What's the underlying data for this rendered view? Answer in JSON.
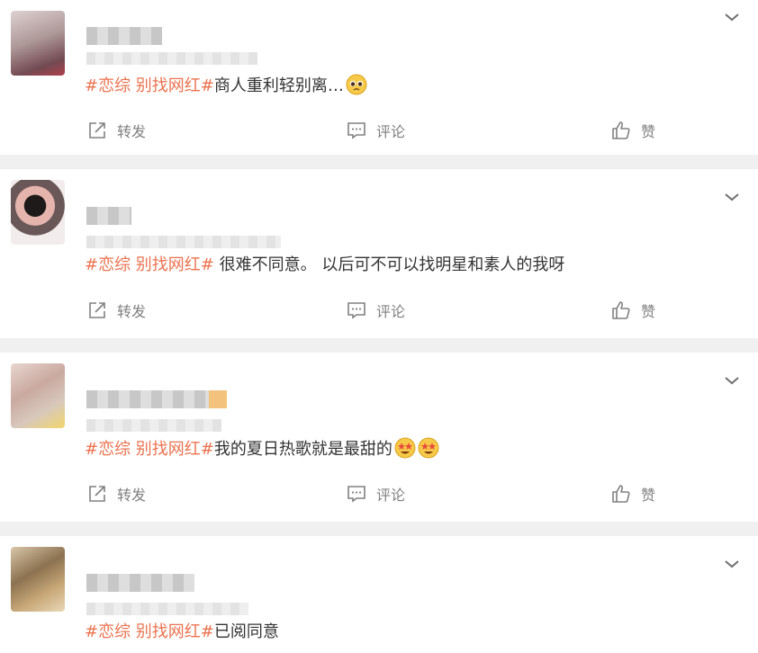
{
  "actions": {
    "repost": "转发",
    "comment": "评论",
    "like": "赞"
  },
  "posts": [
    {
      "hashtag": "#恋综 别找网红#",
      "text": "商人重利轻别离…",
      "emoji": "pleading-face"
    },
    {
      "hashtag": "#恋综 别找网红#",
      "text": " 很难不同意。 以后可不可以找明星和素人的我呀",
      "emoji": ""
    },
    {
      "hashtag": "#恋综 别找网红#",
      "text": "我的夏日热歌就是最甜的",
      "emoji": "star-struck-face x2"
    },
    {
      "hashtag": "#恋综 别找网红#",
      "text": "已阅同意",
      "emoji": ""
    }
  ],
  "colors": {
    "hashtag": "#eb7350",
    "text": "#333333",
    "action": "#808080",
    "separator": "#f0f0f0"
  }
}
